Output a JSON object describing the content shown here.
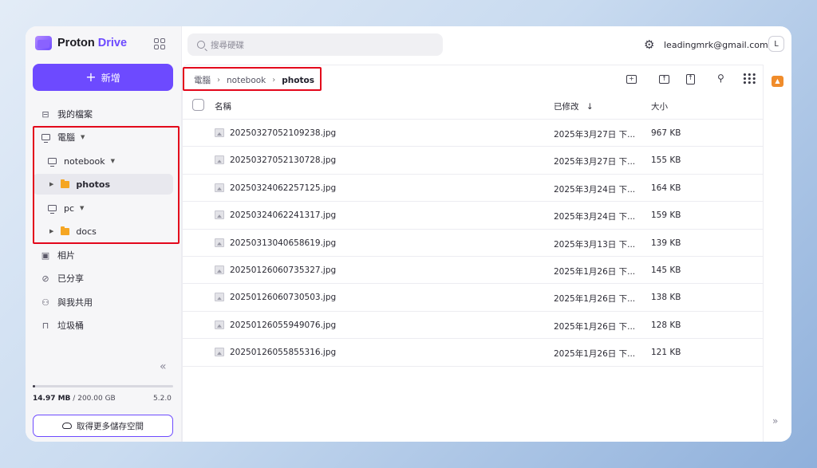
{
  "app": {
    "brand_name": "Proton",
    "brand_product": "Drive"
  },
  "sidebar": {
    "new_button": "新增",
    "items": [
      {
        "label": "我的檔案",
        "icon": "inbox-icon"
      },
      {
        "label": "電腦",
        "icon": "monitor-icon"
      },
      {
        "label": "notebook",
        "icon": "monitor-icon"
      },
      {
        "label": "photos",
        "icon": "folder-icon"
      },
      {
        "label": "pc",
        "icon": "monitor-icon"
      },
      {
        "label": "docs",
        "icon": "folder-icon"
      },
      {
        "label": "相片",
        "icon": "image-icon"
      },
      {
        "label": "已分享",
        "icon": "link-icon"
      },
      {
        "label": "與我共用",
        "icon": "users-icon"
      },
      {
        "label": "垃圾桶",
        "icon": "trash-icon"
      }
    ],
    "storage": {
      "used": "14.97 MB",
      "separator": "/",
      "total": "200.00 GB",
      "used_fraction": 0.0001
    },
    "version": "5.2.0",
    "upgrade_button": "取得更多儲存空間"
  },
  "header": {
    "search_placeholder": "搜尋硬碟",
    "account_email": "leadingmrk@gmail.com",
    "avatar_initial": "L"
  },
  "breadcrumb": [
    "電腦",
    "notebook",
    "photos"
  ],
  "table": {
    "columns": {
      "name": "名稱",
      "modified": "已修改",
      "size": "大小"
    },
    "sort_indicator": "↓",
    "rows": [
      {
        "name": "20250327052109238.jpg",
        "modified": "2025年3月27日 下...",
        "size": "967 KB"
      },
      {
        "name": "20250327052130728.jpg",
        "modified": "2025年3月27日 下...",
        "size": "155 KB"
      },
      {
        "name": "20250324062257125.jpg",
        "modified": "2025年3月24日 下...",
        "size": "164 KB"
      },
      {
        "name": "20250324062241317.jpg",
        "modified": "2025年3月24日 下...",
        "size": "159 KB"
      },
      {
        "name": "20250313040658619.jpg",
        "modified": "2025年3月13日 下...",
        "size": "139 KB"
      },
      {
        "name": "20250126060735327.jpg",
        "modified": "2025年1月26日 下...",
        "size": "145 KB"
      },
      {
        "name": "20250126060730503.jpg",
        "modified": "2025年1月26日 下...",
        "size": "138 KB"
      },
      {
        "name": "20250126055949076.jpg",
        "modified": "2025年1月26日 下...",
        "size": "128 KB"
      },
      {
        "name": "20250126055855316.jpg",
        "modified": "2025年1月26日 下...",
        "size": "121 KB"
      }
    ]
  },
  "colors": {
    "accent": "#6d4aff",
    "highlight_box": "#e3061b",
    "folder": "#f5a623"
  }
}
